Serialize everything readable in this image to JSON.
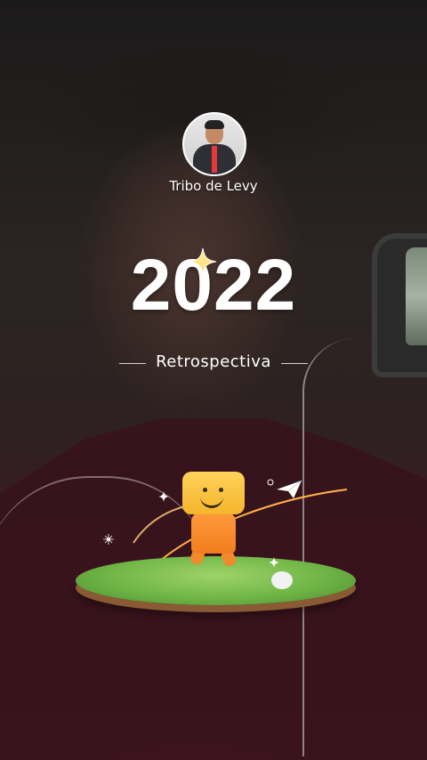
{
  "story": {
    "username": "Tribo de Levy",
    "year": "2022",
    "subtitle": "Retrospectiva"
  },
  "icons": {
    "sparkle": "four-point-star-icon",
    "paper_plane": "paper-plane-icon"
  },
  "colors": {
    "text": "#ffffff",
    "accent_star": "#ffd84a"
  }
}
